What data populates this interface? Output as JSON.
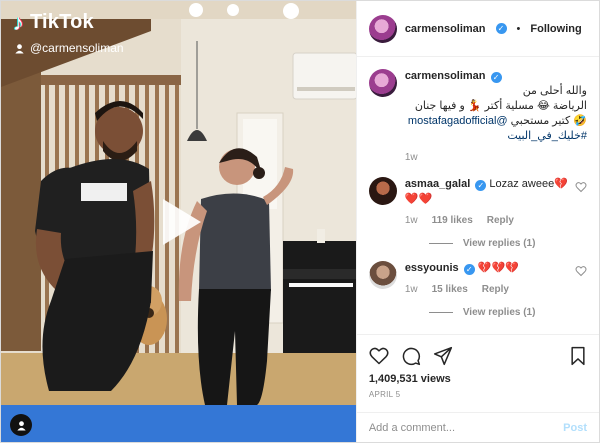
{
  "video": {
    "brand": "TikTok",
    "handle": "@carmensoliman"
  },
  "header": {
    "username": "carmensoliman",
    "separator": "•",
    "follow_state": "Following"
  },
  "caption": {
    "username": "carmensoliman",
    "line1": "والله أحلى من",
    "line2": "الرياضة 😂 مسلية أكتر 💃 و فيها جنان",
    "line3_mention": "@mostafagadofficial",
    "line3_text": "🤣 كتير مستحبي",
    "hashtag": "#خليك_في_البيت",
    "time": "1w"
  },
  "comments": [
    {
      "username": "asmaa_galal",
      "text": "Lozaz aweee💔",
      "text2": "❤️❤️",
      "time": "1w",
      "likes": "119 likes",
      "reply": "Reply",
      "view_replies": "View replies (1)"
    },
    {
      "username": "essyounis",
      "text": "💔💔💔",
      "time": "1w",
      "likes": "15 likes",
      "reply": "Reply",
      "view_replies": "View replies (1)"
    }
  ],
  "stats": {
    "views": "1,409,531 views",
    "date": "APRIL 5"
  },
  "composer": {
    "placeholder": "Add a comment...",
    "post_label": "Post"
  },
  "icons": {
    "like": "heart-icon",
    "comment": "comment-icon",
    "share": "share-icon",
    "save": "bookmark-icon",
    "play": "play-icon",
    "tiktok": "tiktok-logo",
    "user": "user-icon",
    "verified": "verified-badge"
  },
  "colors": {
    "verified": "#3897f0",
    "link": "#003569",
    "muted": "#8e8e8e",
    "post_disabled": "#b2dffc"
  }
}
